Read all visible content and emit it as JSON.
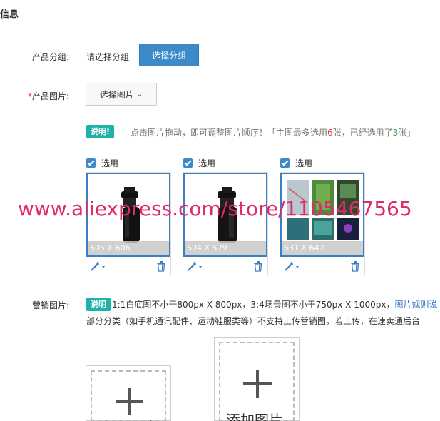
{
  "section": {
    "title": "信息"
  },
  "group": {
    "label": "产品分组:",
    "text": "请选择分组",
    "button": "选择分组"
  },
  "images": {
    "required_mark": "*",
    "label": "产品图片:",
    "select_button": "选择图片",
    "note_tag": "说明!",
    "note_a": "点击图片拖动，即可调整图片顺序！「主图最多选用",
    "note_max": "6",
    "note_b": "张，已经选用了",
    "note_used": "3",
    "note_c": "张」",
    "cards": [
      {
        "checkbox_label": "选用",
        "size": "605 X 606"
      },
      {
        "checkbox_label": "选用",
        "size": "604 X 579"
      },
      {
        "checkbox_label": "选用",
        "size": "631 X 647"
      }
    ]
  },
  "watermark": "www.aliexpress.com/store/1105467565",
  "marketing": {
    "label": "营销图片:",
    "note_tag": "说明",
    "line1": "1:1白底图不小于800px X 800px，3:4场景图不小于750px X 1000px，",
    "link": "图片规则说",
    "line2": "部分分类（如手机通讯配件、运动鞋服类等）不支持上传营销图，若上传，在速卖通后台",
    "add_label": "添加图片"
  },
  "colors": {
    "primary": "#3b8ac9",
    "tag": "#20b2aa",
    "required": "#e4393c",
    "watermark": "#e0296e"
  }
}
